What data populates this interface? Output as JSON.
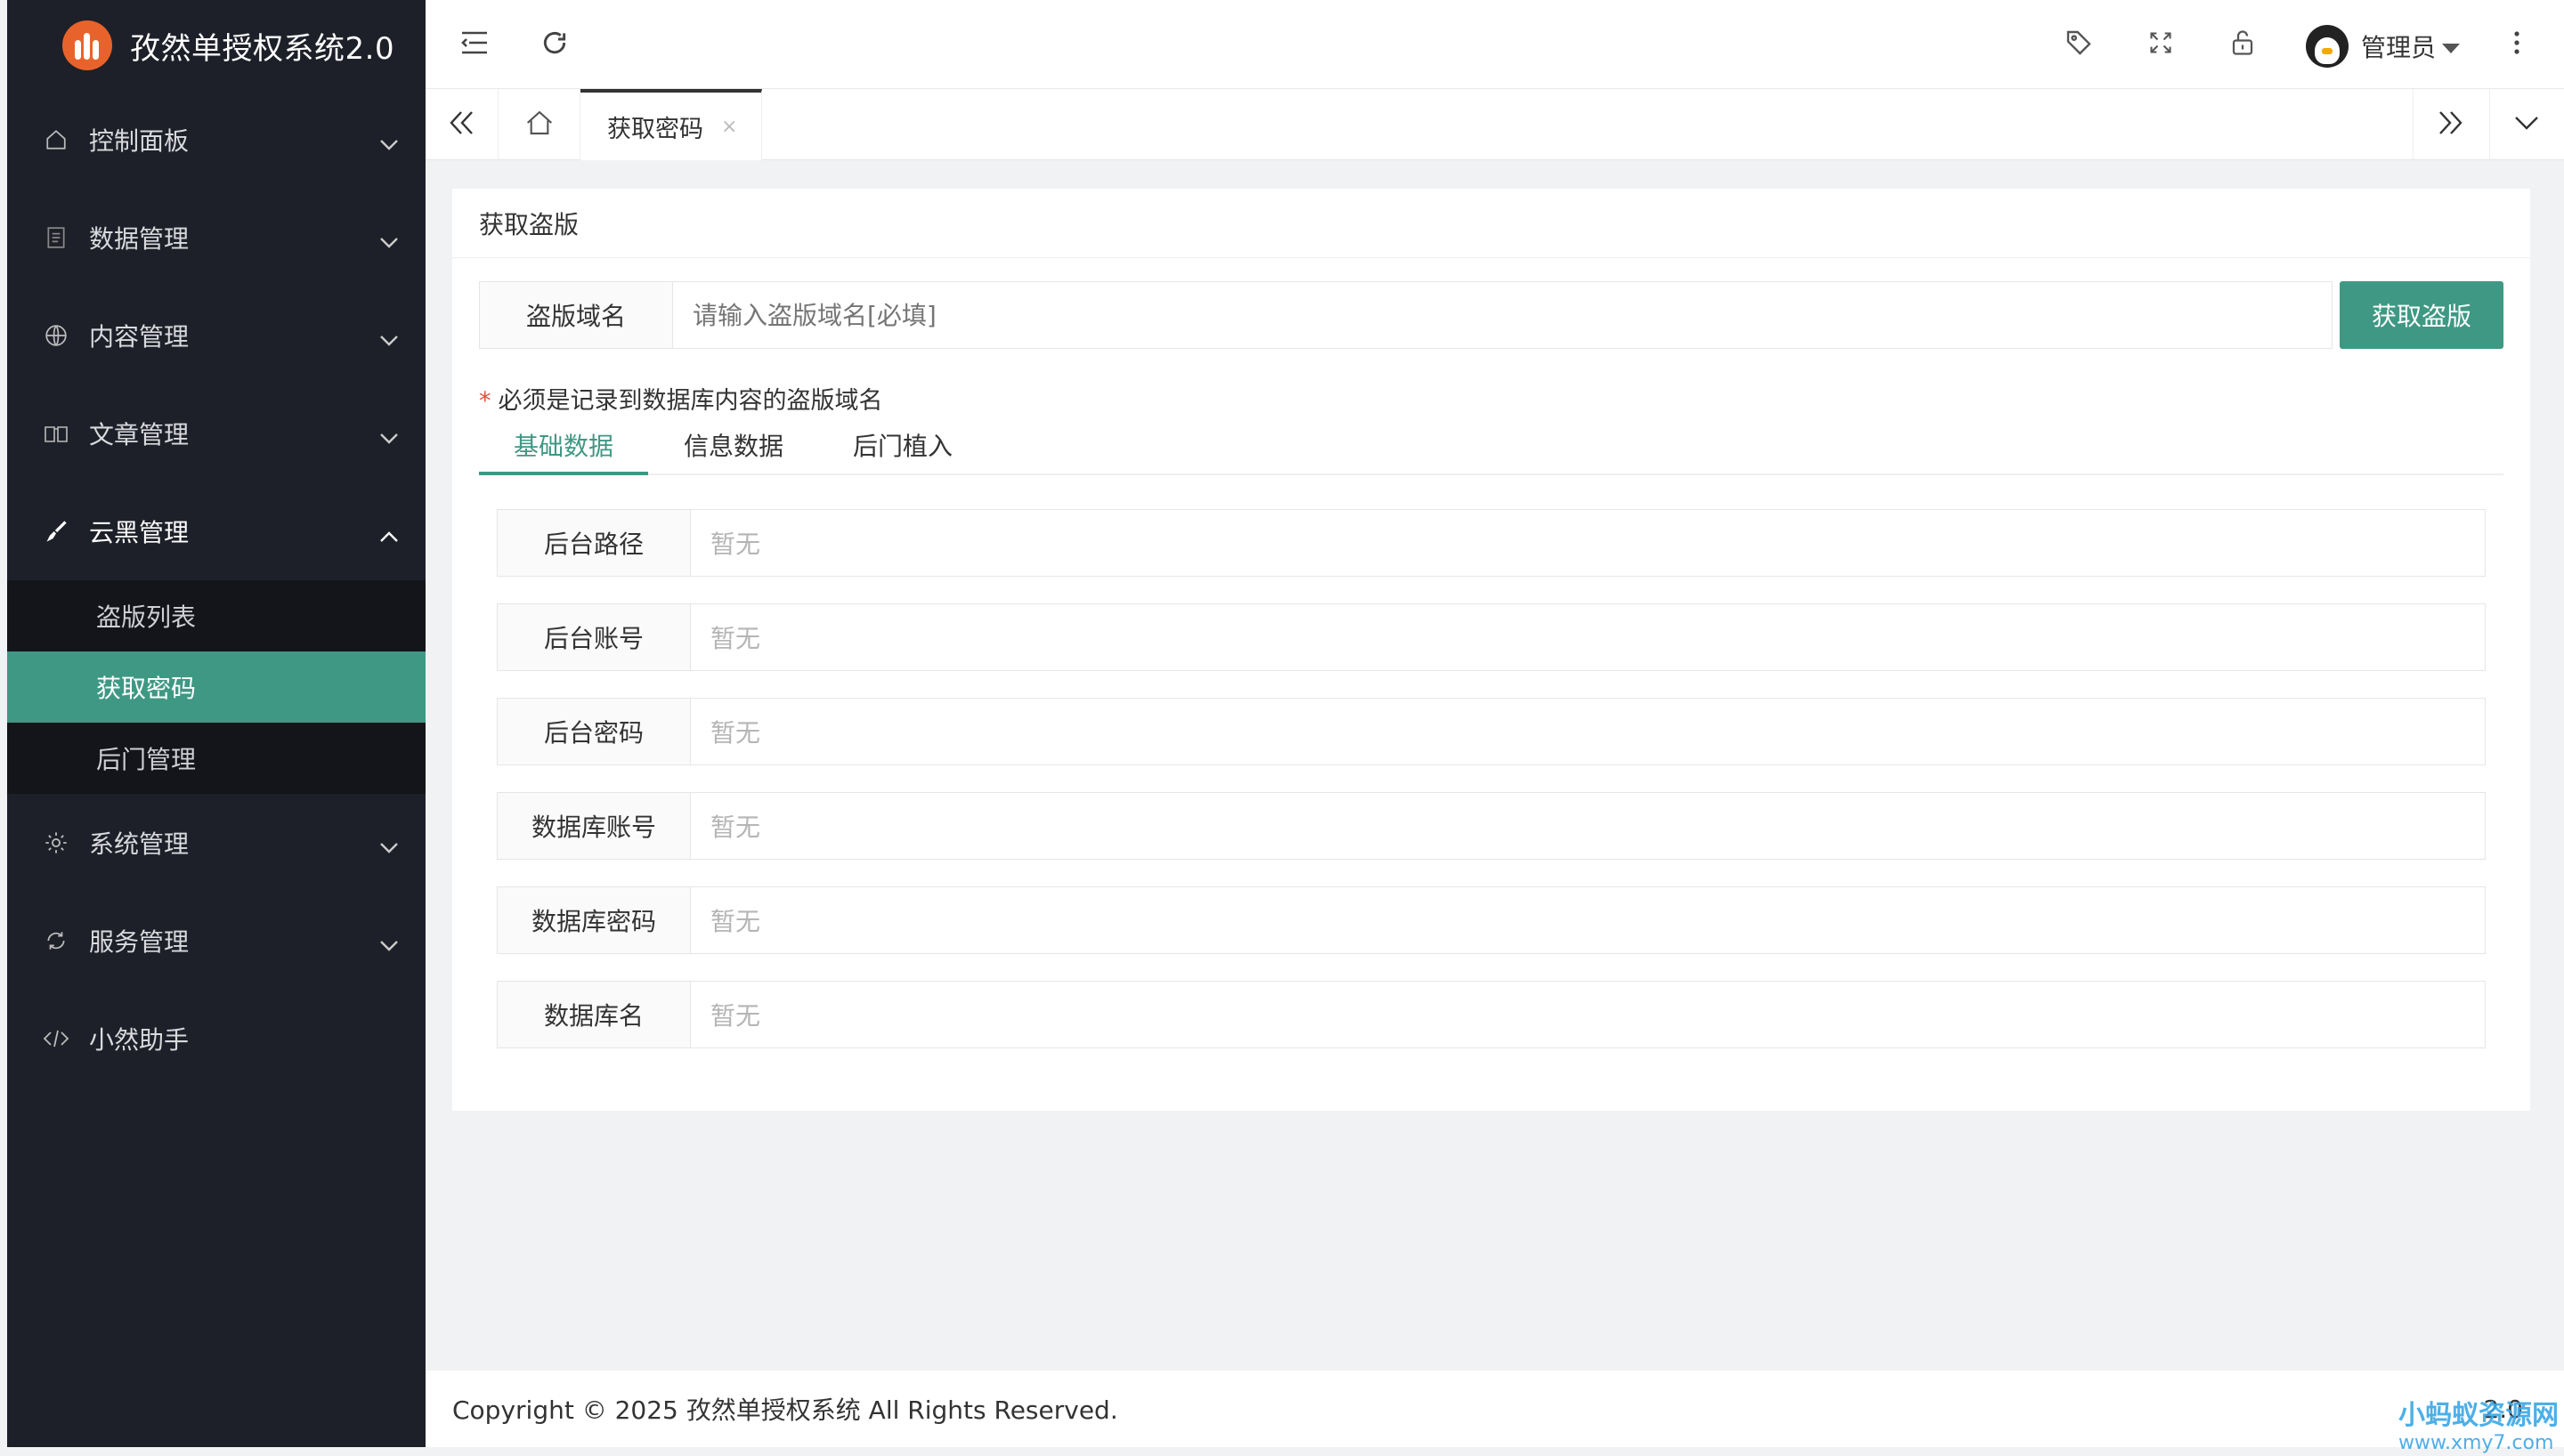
{
  "app": {
    "title": "孜然单授权系统2.0"
  },
  "sidebar": {
    "items": [
      {
        "label": "控制面板",
        "icon": "home-icon"
      },
      {
        "label": "数据管理",
        "icon": "document-icon"
      },
      {
        "label": "内容管理",
        "icon": "globe-icon"
      },
      {
        "label": "文章管理",
        "icon": "book-icon"
      },
      {
        "label": "云黑管理",
        "icon": "brush-icon"
      },
      {
        "label": "系统管理",
        "icon": "gear-icon"
      },
      {
        "label": "服务管理",
        "icon": "sync-icon"
      },
      {
        "label": "小然助手",
        "icon": "code-icon"
      }
    ],
    "submenu": [
      "盗版列表",
      "获取密码",
      "后门管理"
    ],
    "active_submenu": "获取密码"
  },
  "header": {
    "user_name": "管理员"
  },
  "tabbar": {
    "active_tab": "获取密码",
    "close_symbol": "×"
  },
  "main": {
    "card_title": "获取盗版",
    "domain_label": "盗版域名",
    "domain_placeholder": "请输入盗版域名[必填]",
    "submit_label": "获取盗版",
    "hint_star": "*",
    "hint": "必须是记录到数据库内容的盗版域名",
    "tabs": [
      "基础数据",
      "信息数据",
      "后门植入"
    ],
    "active_tab": "基础数据",
    "fields": [
      {
        "label": "后台路径",
        "value": "暂无"
      },
      {
        "label": "后台账号",
        "value": "暂无"
      },
      {
        "label": "后台密码",
        "value": "暂无"
      },
      {
        "label": "数据库账号",
        "value": "暂无"
      },
      {
        "label": "数据库密码",
        "value": "暂无"
      },
      {
        "label": "数据库名",
        "value": "暂无"
      }
    ]
  },
  "footer": {
    "copyright": "Copyright © 2025 孜然单授权系统 All Rights Reserved.",
    "version": "2.0"
  },
  "watermark": {
    "name": "小蚂蚁资源网",
    "url": "www.xmy7.com"
  },
  "colors": {
    "accent": "#3f9884",
    "sidebar_bg": "#1e2029",
    "logo": "#e8632b",
    "required": "#e74c3c"
  }
}
